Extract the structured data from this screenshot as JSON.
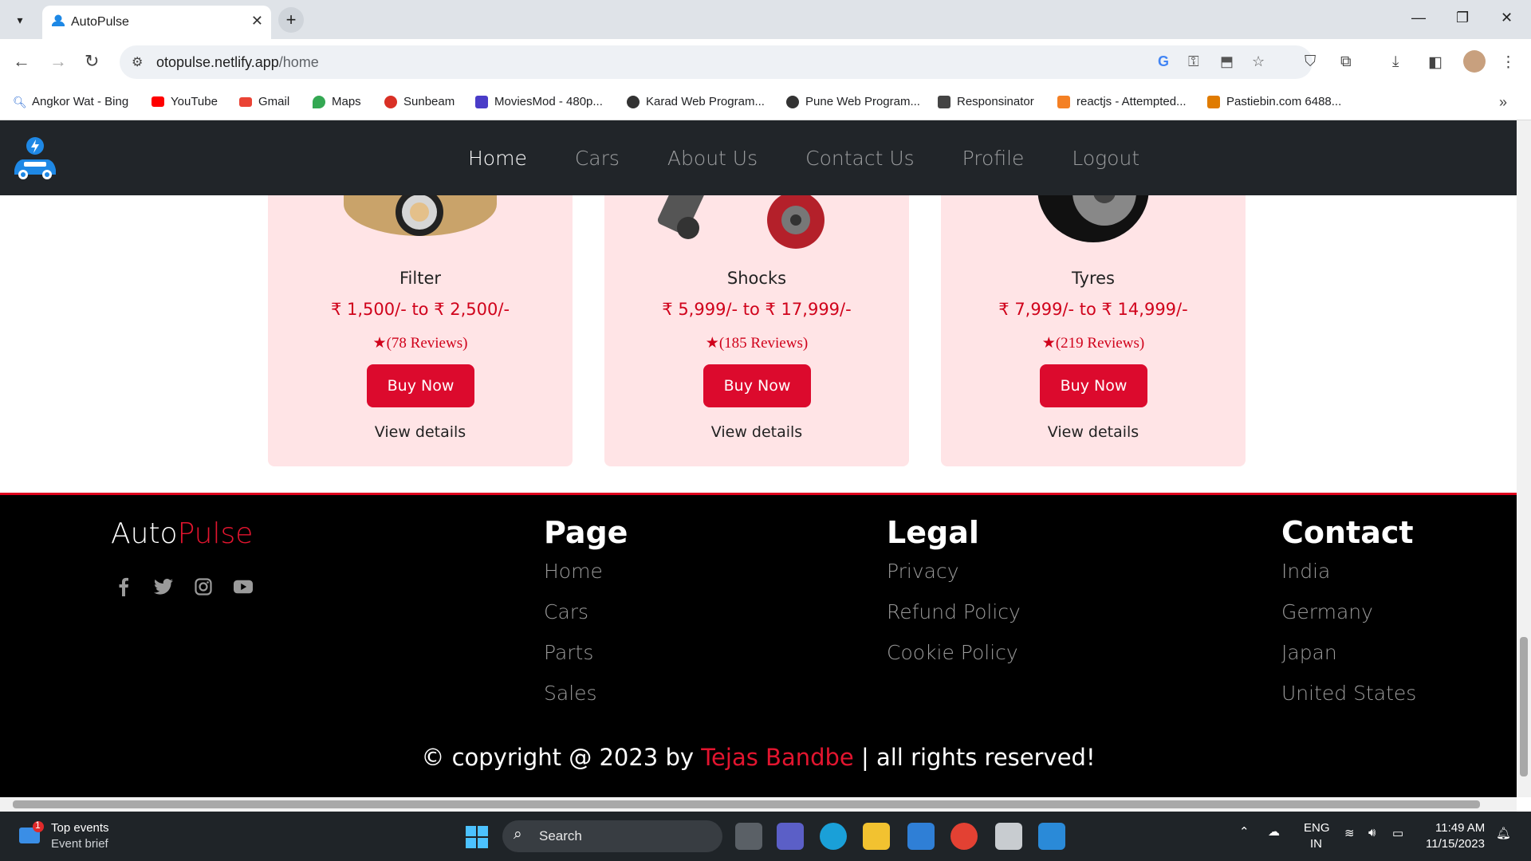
{
  "browser": {
    "tab_title": "AutoPulse",
    "url_host": "otopulse.netlify.app",
    "url_path": "/home",
    "bookmarks": [
      {
        "label": "Angkor Wat - Bing",
        "icon": "bing-search-icon",
        "color": "#2b6cd4"
      },
      {
        "label": "YouTube",
        "icon": "youtube-icon",
        "color": "#ff0000"
      },
      {
        "label": "Gmail",
        "icon": "gmail-icon",
        "color": "#ea4335"
      },
      {
        "label": "Maps",
        "icon": "maps-pin-icon",
        "color": "#34a853"
      },
      {
        "label": "Sunbeam",
        "icon": "sunbeam-icon",
        "color": "#d93025"
      },
      {
        "label": "MoviesMod - 480p...",
        "icon": "moviesmod-icon",
        "color": "#4a3cc8"
      },
      {
        "label": "Karad Web Program...",
        "icon": "globe-icon",
        "color": "#333333"
      },
      {
        "label": "Pune Web Program...",
        "icon": "globe-icon",
        "color": "#333333"
      },
      {
        "label": "Responsinator",
        "icon": "responsinator-icon",
        "color": "#444444"
      },
      {
        "label": "reactjs - Attempted...",
        "icon": "stackoverflow-icon",
        "color": "#f48024"
      },
      {
        "label": "Pastiebin.com 6488...",
        "icon": "pastiebin-icon",
        "color": "#e07b00"
      }
    ]
  },
  "site": {
    "nav": [
      "Home",
      "Cars",
      "About Us",
      "Contact Us",
      "Profile",
      "Logout"
    ],
    "active_nav": "Home",
    "accent_color": "#dc0a2d",
    "products": [
      {
        "name": "Filter",
        "price": "₹ 1,500/- to ₹ 2,500/-",
        "reviews": "(78  Reviews)",
        "button": "Buy Now",
        "link": "View details"
      },
      {
        "name": "Shocks",
        "price": "₹ 5,999/- to ₹ 17,999/-",
        "reviews": "(185  Reviews)",
        "button": "Buy Now",
        "link": "View details"
      },
      {
        "name": "Tyres",
        "price": "₹ 7,999/- to ₹ 14,999/-",
        "reviews": "(219  Reviews)",
        "button": "Buy Now",
        "link": "View details"
      }
    ],
    "footer": {
      "brand_a": "Auto",
      "brand_b": "Pulse",
      "socials": [
        "facebook-icon",
        "twitter-icon",
        "instagram-icon",
        "youtube-icon"
      ],
      "page_heading": "Page",
      "page_links": [
        "Home",
        "Cars",
        "Parts",
        "Sales"
      ],
      "legal_heading": "Legal",
      "legal_links": [
        "Privacy",
        "Refund Policy",
        "Cookie Policy"
      ],
      "contact_heading": "Contact",
      "contact_links": [
        "India",
        "Germany",
        "Japan",
        "United States"
      ],
      "copyright_pre": "© copyright @ 2023 by ",
      "copyright_name": "Tejas Bandbe",
      "copyright_post": " | all rights reserved!"
    }
  },
  "taskbar": {
    "widget_title": "Top events",
    "widget_sub": "Event brief",
    "widget_badge": "1",
    "search_label": "Search",
    "lang_1": "ENG",
    "lang_2": "IN",
    "time": "11:49 AM",
    "date": "11/15/2023"
  }
}
